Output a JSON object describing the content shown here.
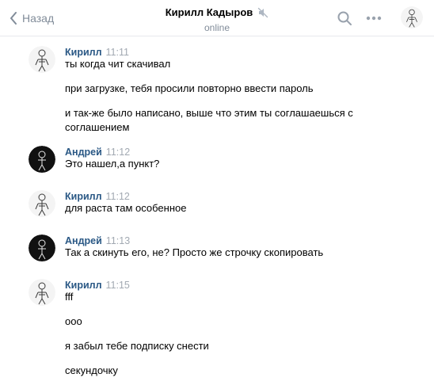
{
  "header": {
    "back_label": "Назад",
    "title": "Кирилл Кадыров",
    "subtitle": "online"
  },
  "messages": [
    {
      "author": "Кирилл",
      "time": "11:11",
      "avatar": "kirill",
      "lines": [
        "ты когда чит скачивал",
        "при загрузке, тебя просили повторно ввести пароль",
        "и так-же было написано, выше что этим ты соглашаешься с соглашением"
      ]
    },
    {
      "author": "Андрей",
      "time": "11:12",
      "avatar": "andrey",
      "lines": [
        "Это нашел,а пункт?"
      ]
    },
    {
      "author": "Кирилл",
      "time": "11:12",
      "avatar": "kirill",
      "lines": [
        "для раста там особенное"
      ]
    },
    {
      "author": "Андрей",
      "time": "11:13",
      "avatar": "andrey",
      "lines": [
        "Так а скинуть его, не? Просто же строчку скопировать"
      ]
    },
    {
      "author": "Кирилл",
      "time": "11:15",
      "avatar": "kirill",
      "lines": [
        "fff",
        "ooo",
        "я забыл тебе подписку снести",
        "секундочку"
      ]
    }
  ],
  "colors": {
    "author": "#2a5885",
    "time": "#a2a9b2",
    "muted": "#818c99",
    "divider": "#e7e8ec"
  },
  "icons": [
    "chevron-left-icon",
    "mute-icon",
    "search-icon",
    "more-icon"
  ]
}
